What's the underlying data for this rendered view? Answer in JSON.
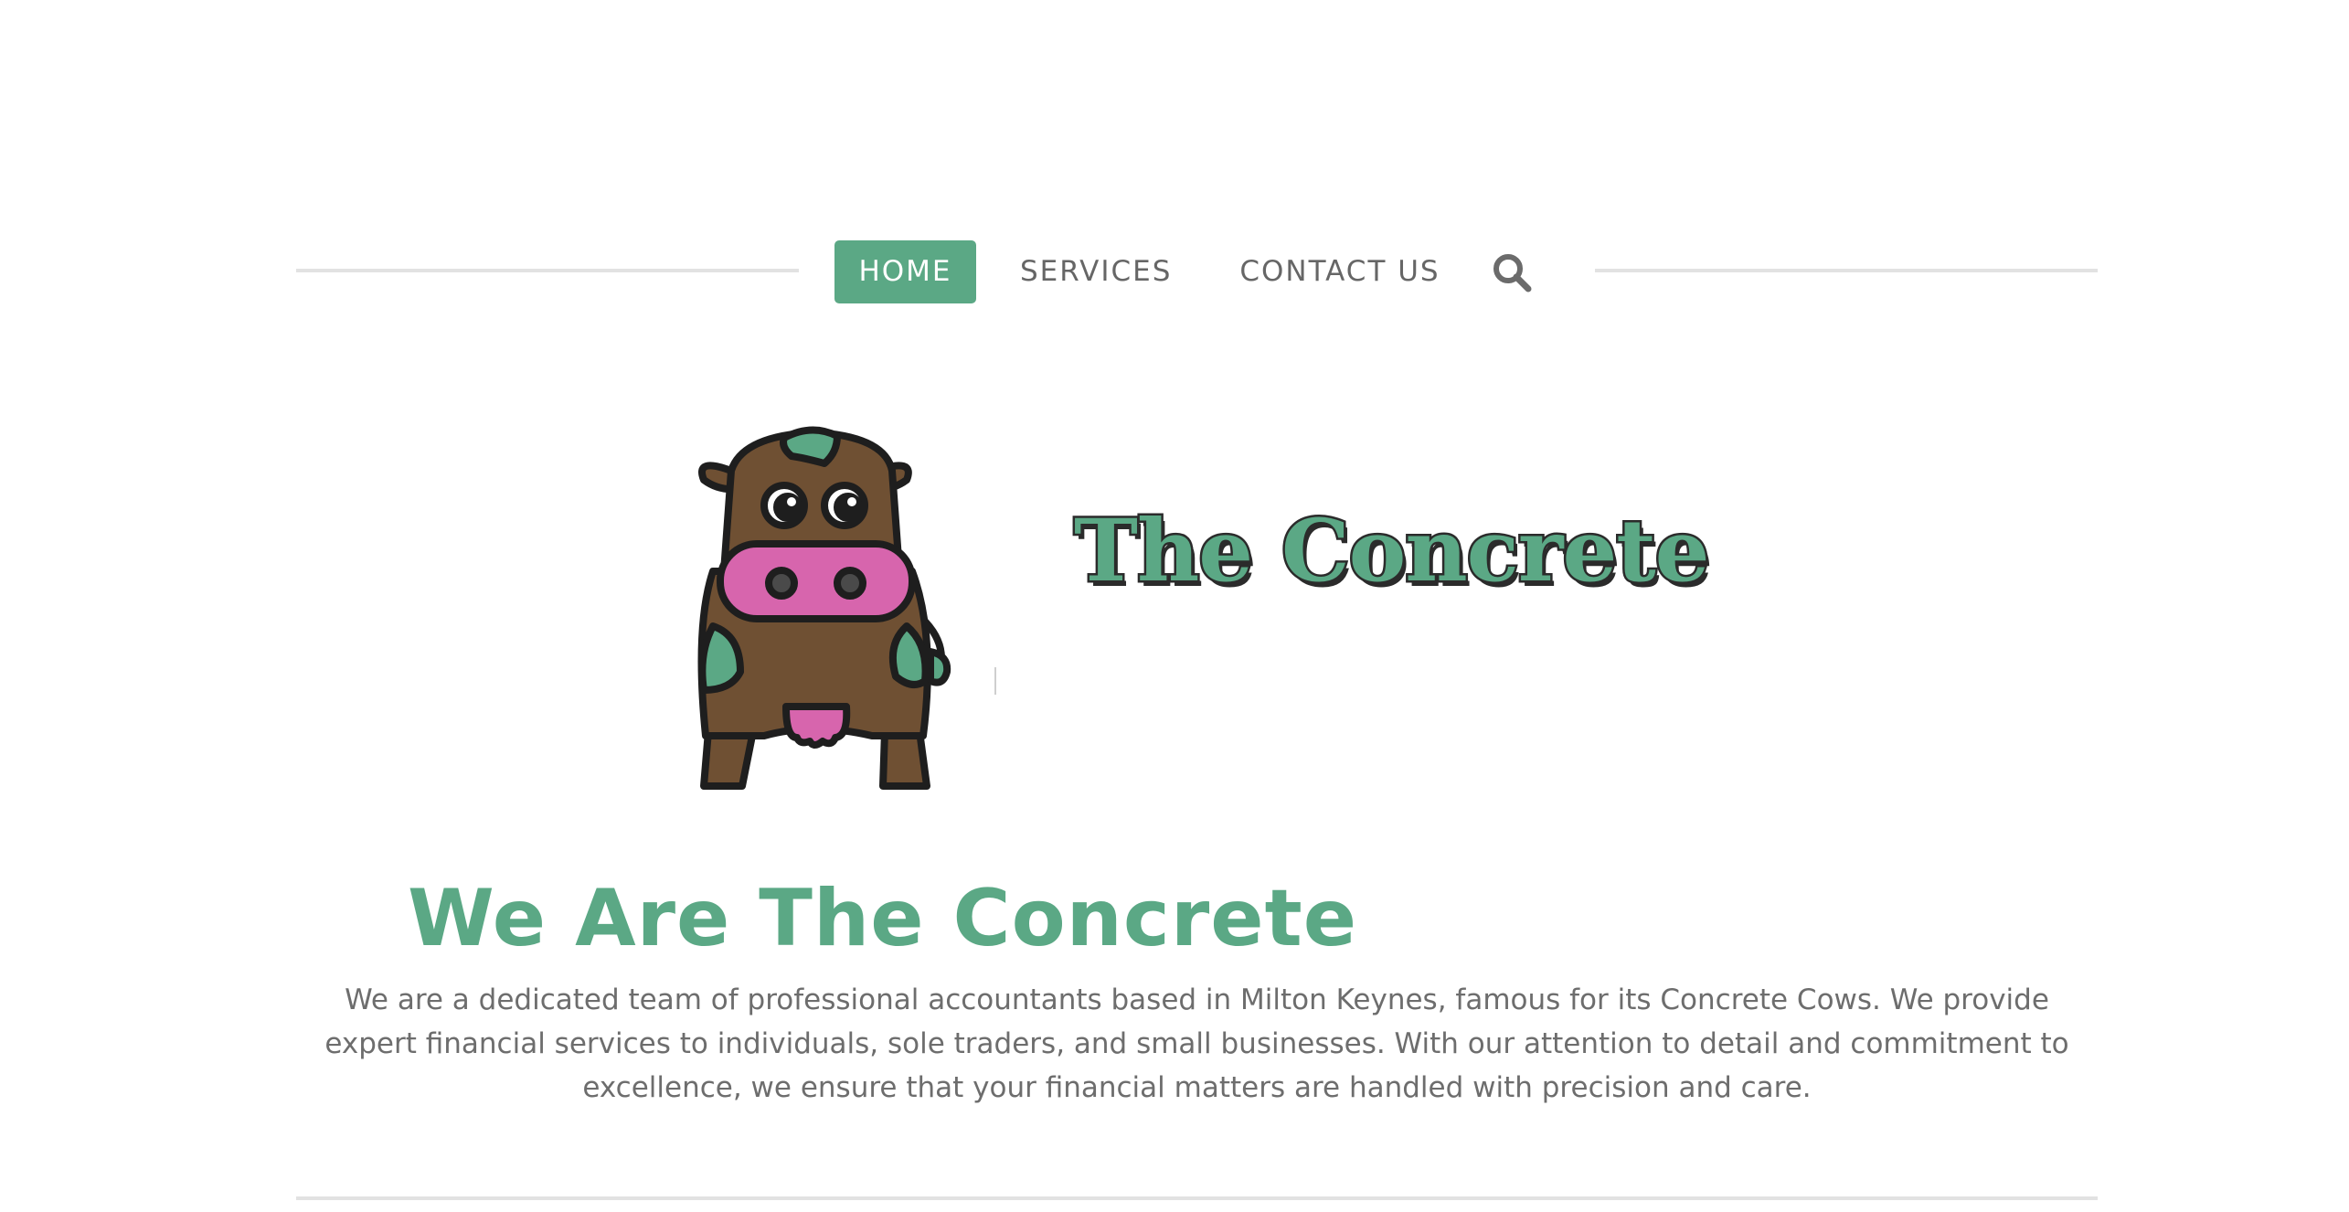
{
  "nav": {
    "items": [
      {
        "label": "HOME",
        "active": true
      },
      {
        "label": "SERVICES",
        "active": false
      },
      {
        "label": "CONTACT US",
        "active": false
      }
    ],
    "search_icon": "search-icon"
  },
  "logo": {
    "wordmark": "The Concrete",
    "mascot": "cow-mascot"
  },
  "hero": {
    "title": "We Are The Concrete",
    "description": "We are a dedicated team of professional accountants based in Milton Keynes, famous for its Concrete Cows. We provide expert financial services to individuals, sole traders, and small businesses. With our attention to detail and commitment to excellence, we ensure that your financial matters are handled with precision and care."
  },
  "colors": {
    "accent": "#5ba885",
    "text": "#6d6d6d",
    "rule": "#e2e2e2",
    "cow_brown": "#6f5033",
    "cow_pink": "#d765ad"
  }
}
